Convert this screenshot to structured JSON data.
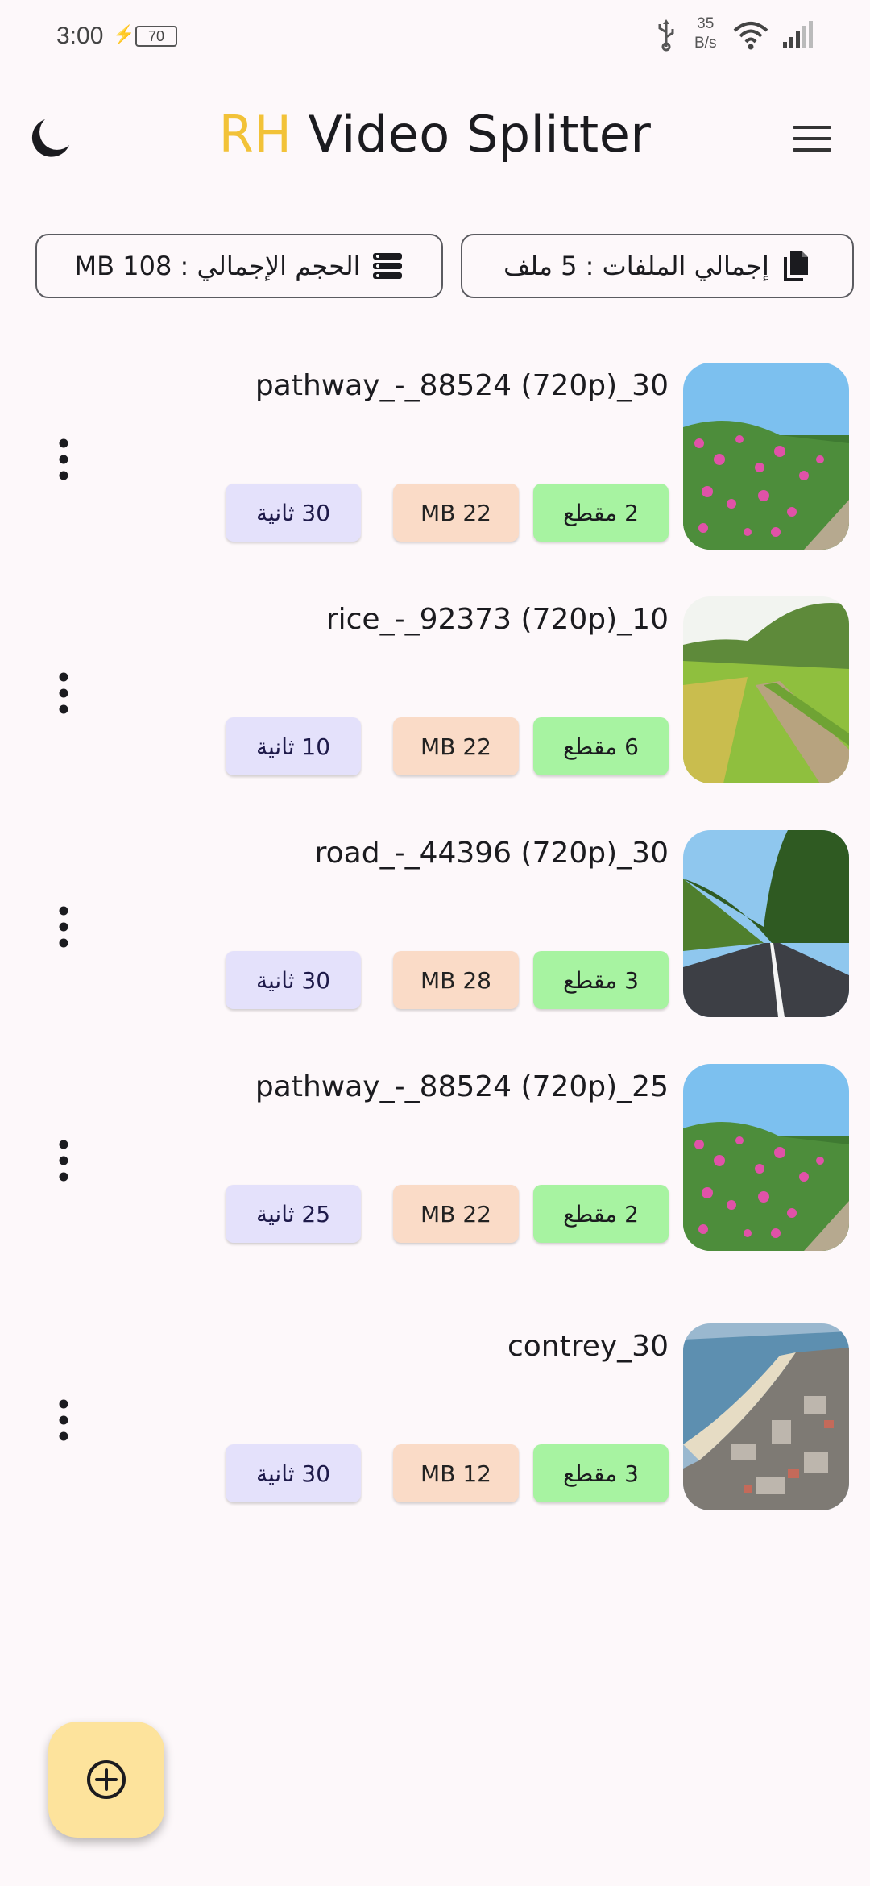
{
  "status_bar": {
    "time": "3:00",
    "battery": "70",
    "net_rate_value": "35",
    "net_rate_unit": "B/s"
  },
  "app": {
    "title_accent": "RH",
    "title_rest": "Video Splitter",
    "accent_color": "#f2c238"
  },
  "summary": {
    "total_size": "الحجم الإجمالي : 108 MB",
    "total_files": "إجمالي الملفات : 5 ملف"
  },
  "videos": [
    {
      "title": "pathway_-_88524 (720p)_30",
      "segments": "2 مقطع",
      "size": "22 MB",
      "duration": "30 ثانية",
      "thumbnail": "flowers"
    },
    {
      "title": "rice_-_92373 (720p)_10",
      "segments": "6 مقطع",
      "size": "22 MB",
      "duration": "10 ثانية",
      "thumbnail": "rice-field"
    },
    {
      "title": "road_-_44396 (720p)_30",
      "segments": "3 مقطع",
      "size": "28 MB",
      "duration": "30 ثانية",
      "thumbnail": "road"
    },
    {
      "title": "pathway_-_88524 (720p)_25",
      "segments": "2 مقطع",
      "size": "22 MB",
      "duration": "25 ثانية",
      "thumbnail": "flowers"
    },
    {
      "title": "contrey_30",
      "segments": "3 مقطع",
      "size": "12 MB",
      "duration": "30 ثانية",
      "thumbnail": "coast-town"
    }
  ],
  "colors": {
    "segments_chip": "#a7f3a1",
    "size_chip": "#fadbc7",
    "duration_chip": "#e4e1fb",
    "fab": "#fde39c"
  },
  "icons": {
    "theme_toggle": "moon-icon",
    "menu": "hamburger-menu-icon",
    "total_size": "storage-icon",
    "total_files": "files-icon",
    "item_menu": "more-vertical-icon",
    "fab": "add-circle-icon"
  }
}
